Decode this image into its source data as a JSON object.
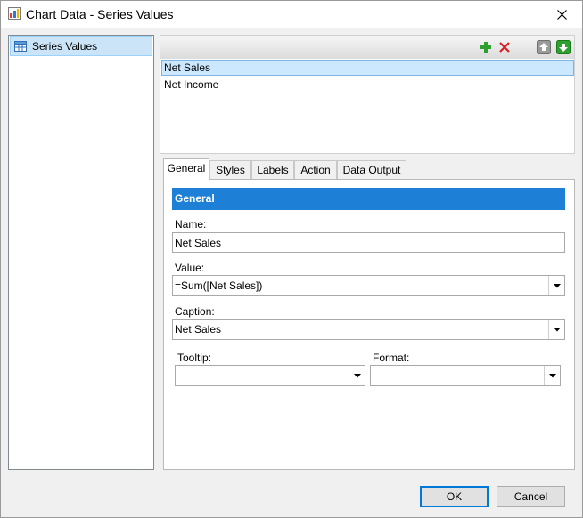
{
  "window": {
    "title": "Chart Data - Series Values"
  },
  "sidebar": {
    "items": [
      {
        "label": "Series Values",
        "icon": "table-icon"
      }
    ]
  },
  "series": {
    "items": [
      {
        "label": "Net Sales",
        "selected": true
      },
      {
        "label": "Net Income",
        "selected": false
      }
    ],
    "toolbar": [
      "add-icon",
      "delete-icon",
      "move-up-icon",
      "move-down-icon"
    ]
  },
  "tabs": [
    {
      "label": "General",
      "active": true
    },
    {
      "label": "Styles"
    },
    {
      "label": "Labels"
    },
    {
      "label": "Action"
    },
    {
      "label": "Data Output"
    }
  ],
  "general": {
    "header": "General",
    "name_label": "Name:",
    "name_value": "Net Sales",
    "value_label": "Value:",
    "value_value": "=Sum([Net Sales])",
    "caption_label": "Caption:",
    "caption_value": "Net Sales",
    "tooltip_label": "Tooltip:",
    "tooltip_value": "",
    "format_label": "Format:",
    "format_value": ""
  },
  "buttons": {
    "ok": "OK",
    "cancel": "Cancel"
  },
  "colors": {
    "accent": "#1e7fd6",
    "selection": "#cce8ff",
    "add": "#2ea02e",
    "delete": "#d62020"
  }
}
